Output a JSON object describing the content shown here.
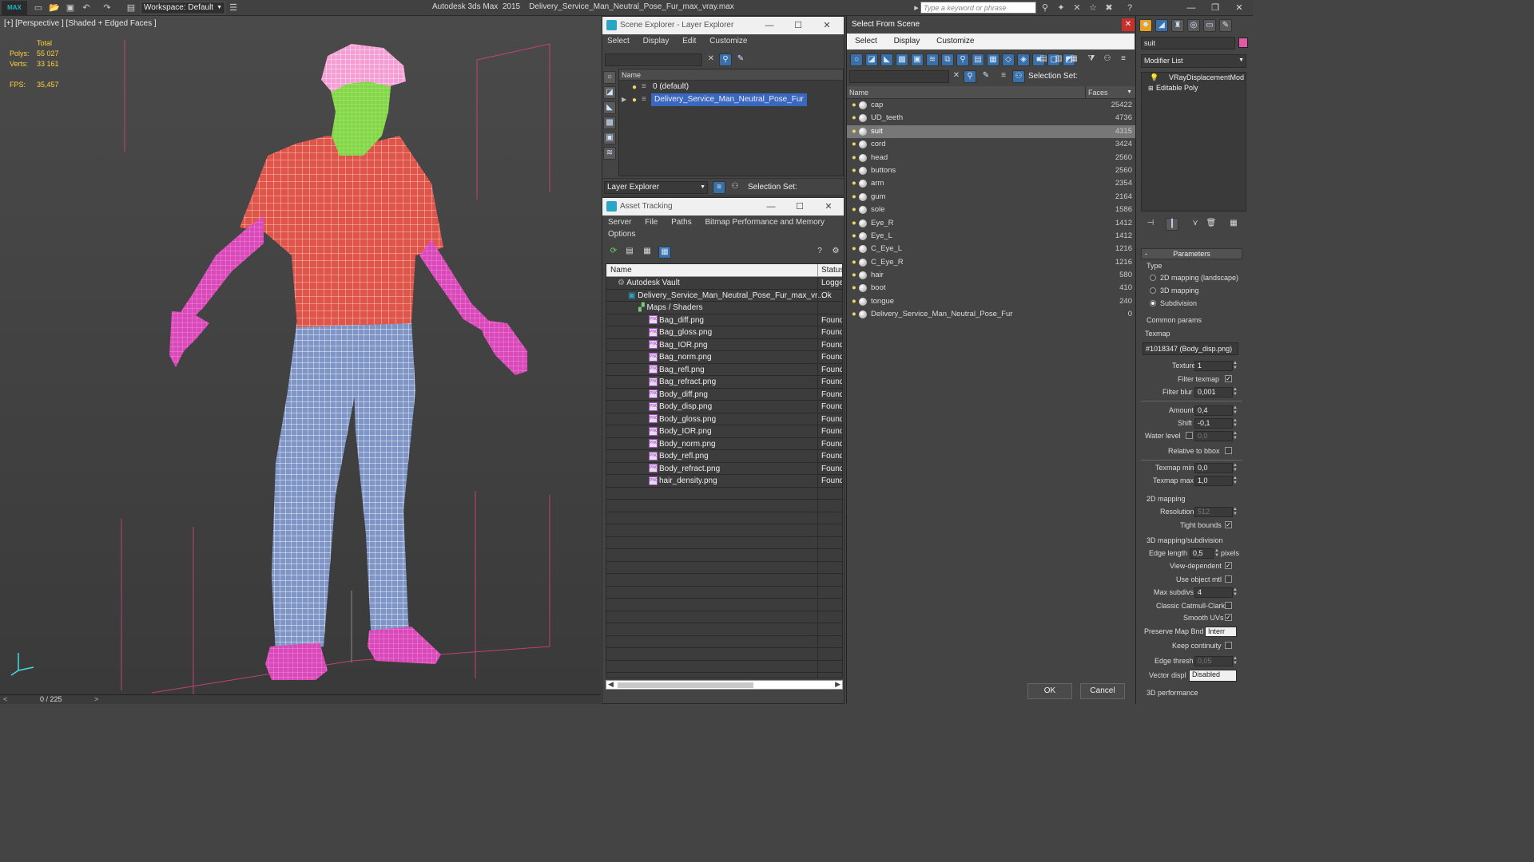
{
  "titlebar": {
    "logo": "MAX",
    "workspace": "Workspace: Default",
    "title": "Autodesk 3ds Max  2015    Delivery_Service_Man_Neutral_Pose_Fur_max_vray.max",
    "search_placeholder": "Type a keyword or phrase"
  },
  "viewport": {
    "label": "[+] [Perspective ] [Shaded + Edged Faces ]",
    "stats": {
      "total_label": "Total",
      "polys_label": "Polys:",
      "polys": "55 027",
      "verts_label": "Verts:",
      "verts": "33 161",
      "fps_label": "FPS:",
      "fps": "35,457"
    },
    "timeline": {
      "value": "0 / 225",
      "prev": "<",
      "next": ">"
    }
  },
  "scene_explorer": {
    "title": "Scene Explorer - Layer Explorer",
    "menus": [
      "Select",
      "Display",
      "Edit",
      "Customize"
    ],
    "col_name": "Name",
    "layers": [
      {
        "name": "0 (default)",
        "selected": false
      },
      {
        "name": "Delivery_Service_Man_Neutral_Pose_Fur",
        "selected": true
      }
    ],
    "footer_dropdown": "Layer Explorer",
    "selection_set_label": "Selection Set:"
  },
  "asset_tracking": {
    "title": "Asset Tracking",
    "menus": [
      "Server",
      "File",
      "Paths",
      "Bitmap Performance and Memory"
    ],
    "menus2": [
      "Options"
    ],
    "col_name": "Name",
    "col_status": "Status",
    "rows": [
      {
        "name": "Autodesk Vault",
        "status": "Logged",
        "indent": 0,
        "kind": "vault"
      },
      {
        "name": "Delivery_Service_Man_Neutral_Pose_Fur_max_vr...",
        "status": "Ok",
        "indent": 1,
        "kind": "file"
      },
      {
        "name": "Maps / Shaders",
        "status": "",
        "indent": 2,
        "kind": "folder"
      },
      {
        "name": "Bag_diff.png",
        "status": "Found",
        "indent": 3,
        "kind": "png"
      },
      {
        "name": "Bag_gloss.png",
        "status": "Found",
        "indent": 3,
        "kind": "png"
      },
      {
        "name": "Bag_IOR.png",
        "status": "Found",
        "indent": 3,
        "kind": "png"
      },
      {
        "name": "Bag_norm.png",
        "status": "Found",
        "indent": 3,
        "kind": "png"
      },
      {
        "name": "Bag_refl.png",
        "status": "Found",
        "indent": 3,
        "kind": "png"
      },
      {
        "name": "Bag_refract.png",
        "status": "Found",
        "indent": 3,
        "kind": "png"
      },
      {
        "name": "Body_diff.png",
        "status": "Found",
        "indent": 3,
        "kind": "png"
      },
      {
        "name": "Body_disp.png",
        "status": "Found",
        "indent": 3,
        "kind": "png"
      },
      {
        "name": "Body_gloss.png",
        "status": "Found",
        "indent": 3,
        "kind": "png"
      },
      {
        "name": "Body_IOR.png",
        "status": "Found",
        "indent": 3,
        "kind": "png"
      },
      {
        "name": "Body_norm.png",
        "status": "Found",
        "indent": 3,
        "kind": "png"
      },
      {
        "name": "Body_refl.png",
        "status": "Found",
        "indent": 3,
        "kind": "png"
      },
      {
        "name": "Body_refract.png",
        "status": "Found",
        "indent": 3,
        "kind": "png"
      },
      {
        "name": "hair_density.png",
        "status": "Found",
        "indent": 3,
        "kind": "png"
      }
    ]
  },
  "select_from_scene": {
    "title": "Select From Scene",
    "menus": [
      "Select",
      "Display",
      "Customize"
    ],
    "selection_set_label": "Selection Set:",
    "col_name": "Name",
    "col_faces": "Faces",
    "objects": [
      {
        "name": "cap",
        "faces": "25422",
        "selected": false
      },
      {
        "name": "UD_teeth",
        "faces": "4736",
        "selected": false
      },
      {
        "name": "suit",
        "faces": "4315",
        "selected": true
      },
      {
        "name": "cord",
        "faces": "3424",
        "selected": false
      },
      {
        "name": "head",
        "faces": "2560",
        "selected": false
      },
      {
        "name": "buttons",
        "faces": "2560",
        "selected": false
      },
      {
        "name": "arm",
        "faces": "2354",
        "selected": false
      },
      {
        "name": "gum",
        "faces": "2164",
        "selected": false
      },
      {
        "name": "sole",
        "faces": "1586",
        "selected": false
      },
      {
        "name": "Eye_R",
        "faces": "1412",
        "selected": false
      },
      {
        "name": "Eye_L",
        "faces": "1412",
        "selected": false
      },
      {
        "name": "C_Eye_L",
        "faces": "1216",
        "selected": false
      },
      {
        "name": "C_Eye_R",
        "faces": "1216",
        "selected": false
      },
      {
        "name": "hair",
        "faces": "580",
        "selected": false
      },
      {
        "name": "boot",
        "faces": "410",
        "selected": false
      },
      {
        "name": "tongue",
        "faces": "240",
        "selected": false
      },
      {
        "name": "Delivery_Service_Man_Neutral_Pose_Fur",
        "faces": "0",
        "selected": false
      }
    ],
    "ok_label": "OK",
    "cancel_label": "Cancel"
  },
  "command_panel": {
    "object_name": "suit",
    "modifier_list": "Modifier List",
    "stack": [
      "VRayDisplacementMod",
      "Editable Poly"
    ],
    "rollout_title": "Parameters",
    "type_label": "Type",
    "type_options": [
      {
        "label": "2D mapping (landscape)",
        "on": false
      },
      {
        "label": "3D mapping",
        "on": false
      },
      {
        "label": "Subdivision",
        "on": true
      }
    ],
    "common_params": "Common params",
    "texmap_label": "Texmap",
    "texmap_value": "#1018347 (Body_disp.png)",
    "texture_chan_label": "Texture chan",
    "texture_chan": "1",
    "filter_texmap_label": "Filter texmap",
    "filter_blur_label": "Filter blur",
    "filter_blur": "0,001",
    "amount_label": "Amount",
    "amount": "0,4",
    "shift_label": "Shift",
    "shift": "-0,1",
    "water_level_label": "Water level",
    "water_level": "0,0",
    "relative_bbox_label": "Relative to bbox",
    "texmap_min_label": "Texmap min",
    "texmap_min": "0,0",
    "texmap_max_label": "Texmap max",
    "texmap_max": "1,0",
    "mapping2d_label": "2D mapping",
    "resolution_label": "Resolution",
    "resolution": "512",
    "tight_bounds_label": "Tight bounds",
    "mapping3d_label": "3D mapping/subdivision",
    "edge_length_label": "Edge length",
    "edge_length": "0,5",
    "pixels_label": "pixels",
    "view_dependent_label": "View-dependent",
    "use_object_mtl_label": "Use object mtl",
    "max_subdivs_label": "Max subdivs",
    "max_subdivs": "4",
    "classic_cc_label": "Classic Catmull-Clark",
    "smooth_uvs_label": "Smooth UVs",
    "preserve_map_label": "Preserve Map Bnd",
    "preserve_map": "Interr",
    "keep_continuity_label": "Keep continuity",
    "edge_thresh_label": "Edge thresh",
    "edge_thresh": "0,05",
    "vector_displ_label": "Vector displ",
    "vector_displ": "Disabled",
    "perf_label": "3D performance"
  }
}
